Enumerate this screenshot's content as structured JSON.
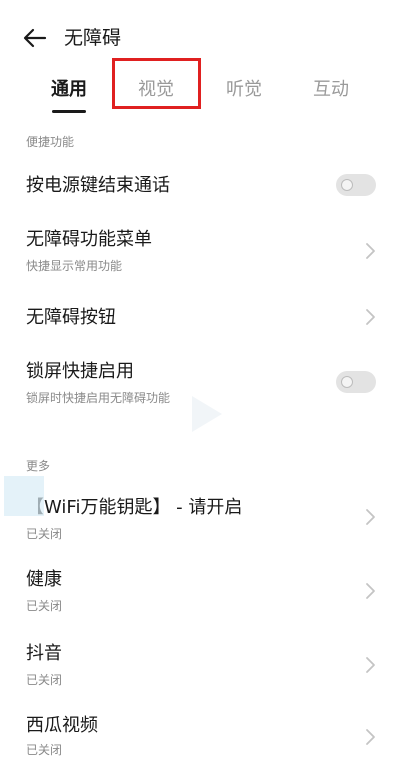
{
  "header": {
    "title": "无障碍",
    "back_icon": "arrow-left-icon"
  },
  "tabs": [
    {
      "label": "通用",
      "active": true
    },
    {
      "label": "视觉",
      "active": false
    },
    {
      "label": "听觉",
      "active": false
    },
    {
      "label": "互动",
      "active": false
    }
  ],
  "sections": {
    "shortcuts": {
      "label": "便捷功能",
      "items": [
        {
          "title": "按电源键结束通话",
          "subtitle": "",
          "control": "toggle",
          "on": false
        },
        {
          "title": "无障碍功能菜单",
          "subtitle": "快捷显示常用功能",
          "control": "chevron"
        },
        {
          "title": "无障碍按钮",
          "subtitle": "",
          "control": "chevron"
        },
        {
          "title": "锁屏快捷启用",
          "subtitle": "锁屏时快捷启用无障碍功能",
          "control": "toggle",
          "on": false
        }
      ]
    },
    "more": {
      "label": "更多",
      "items": [
        {
          "title": "【WiFi万能钥匙】 - 请开启",
          "subtitle": "已关闭",
          "control": "chevron"
        },
        {
          "title": "健康",
          "subtitle": "已关闭",
          "control": "chevron"
        },
        {
          "title": "抖音",
          "subtitle": "已关闭",
          "control": "chevron"
        },
        {
          "title": "西瓜视频",
          "subtitle": "已关闭",
          "control": "chevron"
        }
      ]
    }
  },
  "colors": {
    "highlight": "#e02020",
    "text_primary": "#1a1a1a",
    "text_secondary": "#8a8a8a"
  }
}
